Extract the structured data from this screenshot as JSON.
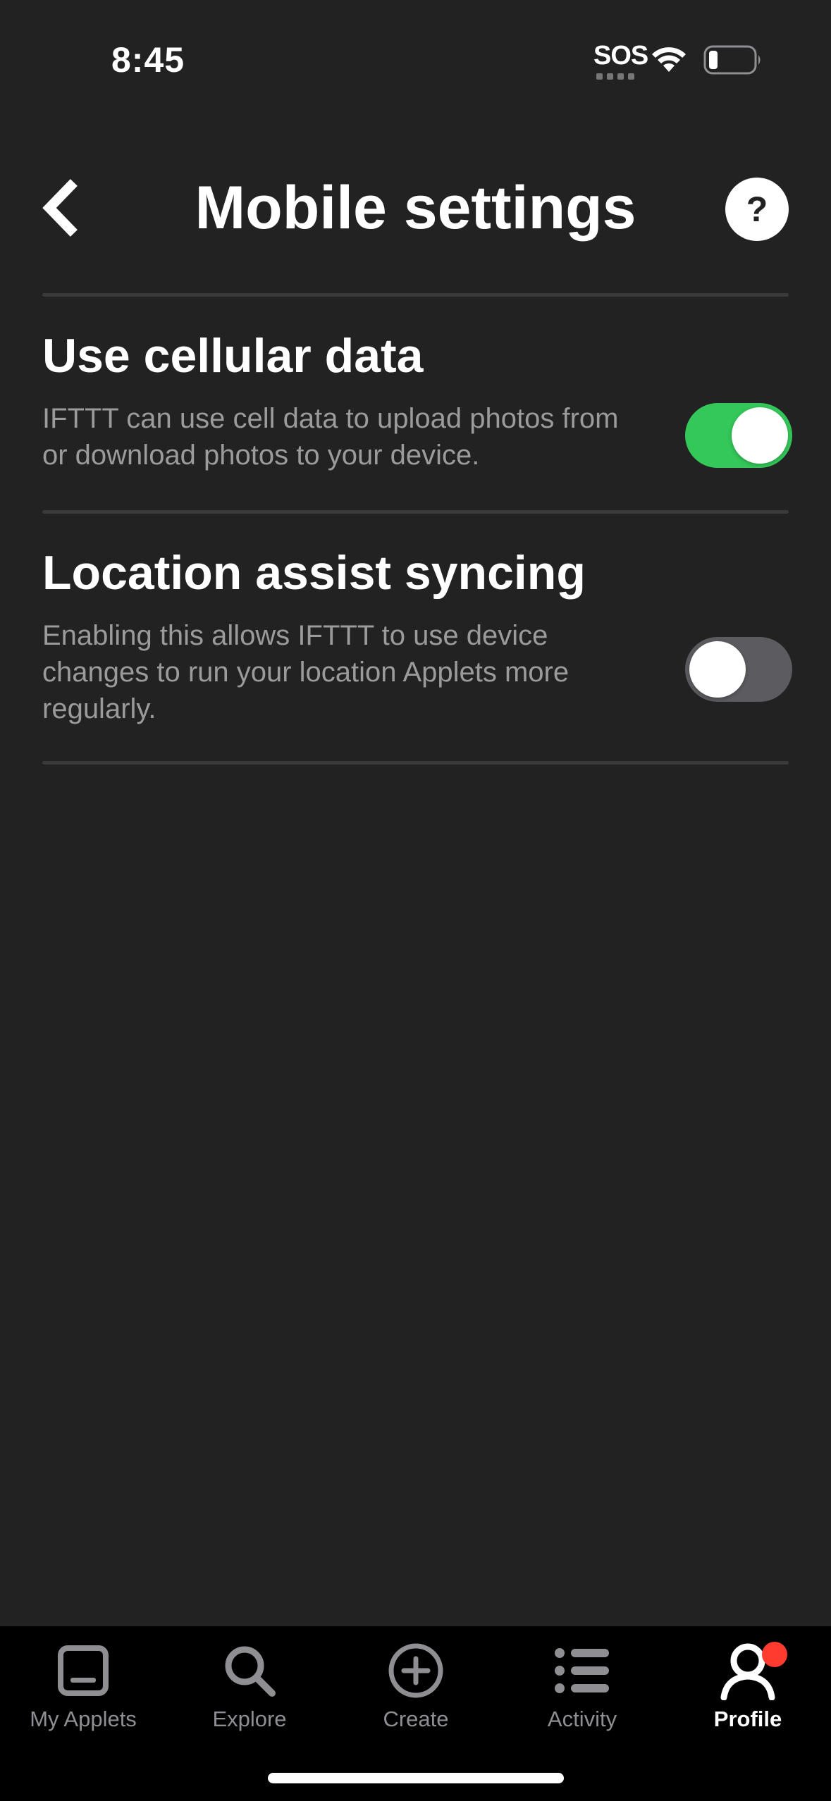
{
  "status_bar": {
    "time": "8:45",
    "sos": "SOS",
    "icons": [
      "wifi-icon",
      "battery-icon"
    ]
  },
  "header": {
    "title": "Mobile settings",
    "back_icon": "chevron-left-icon",
    "help_label": "?"
  },
  "settings": [
    {
      "title": "Use cellular data",
      "description": "IFTTT can use cell data to upload photos from or download photos to your device.",
      "enabled": true
    },
    {
      "title": "Location assist syncing",
      "description": "Enabling this allows IFTTT to use device changes to run your location Applets more regularly.",
      "enabled": false
    }
  ],
  "tab_bar": {
    "tabs": [
      {
        "label": "My Applets",
        "icon": "my-applets-icon",
        "active": false
      },
      {
        "label": "Explore",
        "icon": "search-icon",
        "active": false
      },
      {
        "label": "Create",
        "icon": "plus-circle-icon",
        "active": false
      },
      {
        "label": "Activity",
        "icon": "list-icon",
        "active": false
      },
      {
        "label": "Profile",
        "icon": "profile-icon",
        "active": true,
        "badge": true
      }
    ]
  },
  "colors": {
    "background": "#222222",
    "toggle_on": "#34c759",
    "toggle_off": "#5c5c60",
    "badge": "#ff3b30",
    "tab_bar": "#000000"
  }
}
